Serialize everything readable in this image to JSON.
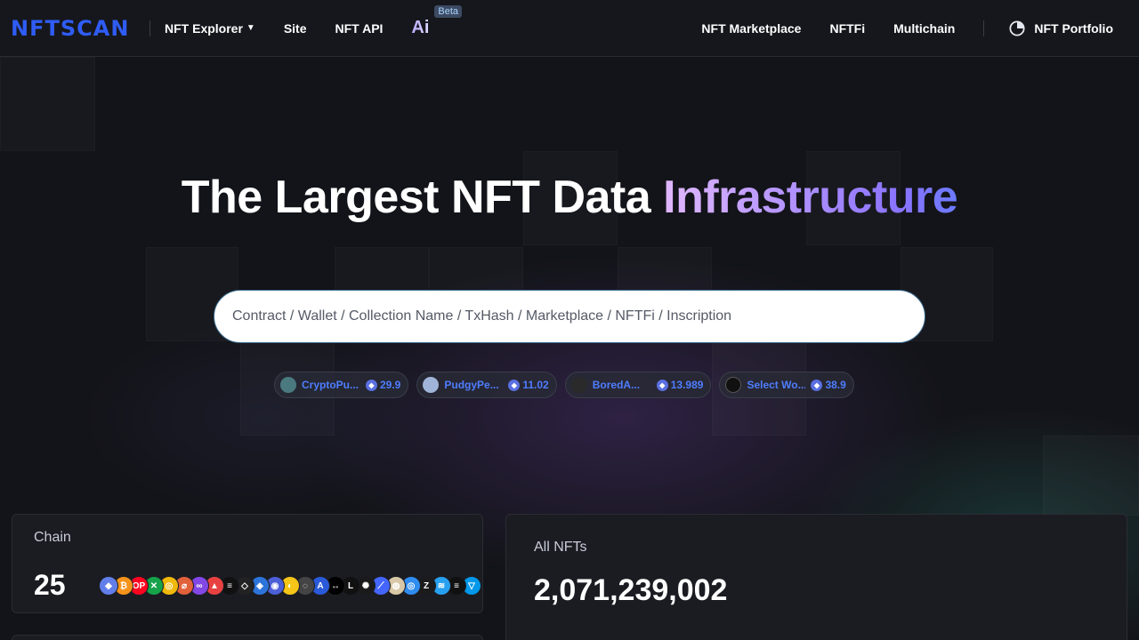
{
  "header": {
    "logo": "NFTSCAN",
    "nav_left": [
      {
        "label": "NFT Explorer",
        "has_dropdown": true
      },
      {
        "label": "Site"
      },
      {
        "label": "NFT API"
      }
    ],
    "ai_label": "Ai",
    "ai_badge": "Beta",
    "nav_right": [
      {
        "label": "NFT Marketplace"
      },
      {
        "label": "NFTFi"
      },
      {
        "label": "Multichain"
      }
    ],
    "portfolio_label": "NFT Portfolio"
  },
  "hero": {
    "title_main": "The Largest NFT Data ",
    "title_accent": "Infrastructure"
  },
  "search": {
    "placeholder": "Contract / Wallet / Collection Name / TxHash / Marketplace / NFTFi / Inscription"
  },
  "trending": [
    {
      "name": "CryptoPu...",
      "price": "29.9",
      "avatar_color": "#4a7a80"
    },
    {
      "name": "PudgyPe...",
      "price": "11.02",
      "avatar_color": "#9fb4d8"
    },
    {
      "name": "BoredA...",
      "price": "13.989",
      "avatar_color": "#2a2a2a"
    },
    {
      "name": "Select Wo...",
      "price": "38.9",
      "avatar_color": "#111111"
    }
  ],
  "stats": {
    "chain_label": "Chain",
    "chain_count": "25",
    "nfts_label": "All NFTs",
    "nfts_count": "2,071,239,002"
  },
  "chain_icons": [
    {
      "glyph": "◆",
      "color": "#627eea"
    },
    {
      "glyph": "₿",
      "color": "#f7931a"
    },
    {
      "glyph": "OP",
      "color": "#ff0420"
    },
    {
      "glyph": "✕",
      "color": "#16a34a"
    },
    {
      "glyph": "◎",
      "color": "#f0b90b"
    },
    {
      "glyph": "⌀",
      "color": "#e0613a"
    },
    {
      "glyph": "∞",
      "color": "#8247e5"
    },
    {
      "glyph": "▲",
      "color": "#e84142"
    },
    {
      "glyph": "≡",
      "color": "#111111"
    },
    {
      "glyph": "◇",
      "color": "#222222"
    },
    {
      "glyph": "◈",
      "color": "#2d74da"
    },
    {
      "glyph": "◉",
      "color": "#4c5fd6"
    },
    {
      "glyph": "◐",
      "color": "#f5c518"
    },
    {
      "glyph": "◌",
      "color": "#444444"
    },
    {
      "glyph": "A",
      "color": "#2a5ada"
    },
    {
      "glyph": "↔",
      "color": "#000000"
    },
    {
      "glyph": "L",
      "color": "#111111"
    },
    {
      "glyph": "✺",
      "color": "#1a1a1a"
    },
    {
      "glyph": "⟋",
      "color": "#4466ff"
    },
    {
      "glyph": "◍",
      "color": "#d9c8a8"
    },
    {
      "glyph": "◎",
      "color": "#2f8cf0"
    },
    {
      "glyph": "Z",
      "color": "#1b1b1b"
    },
    {
      "glyph": "≋",
      "color": "#28a0f0"
    },
    {
      "glyph": "≡",
      "color": "#111111"
    },
    {
      "glyph": "▽",
      "color": "#0098ea"
    }
  ]
}
